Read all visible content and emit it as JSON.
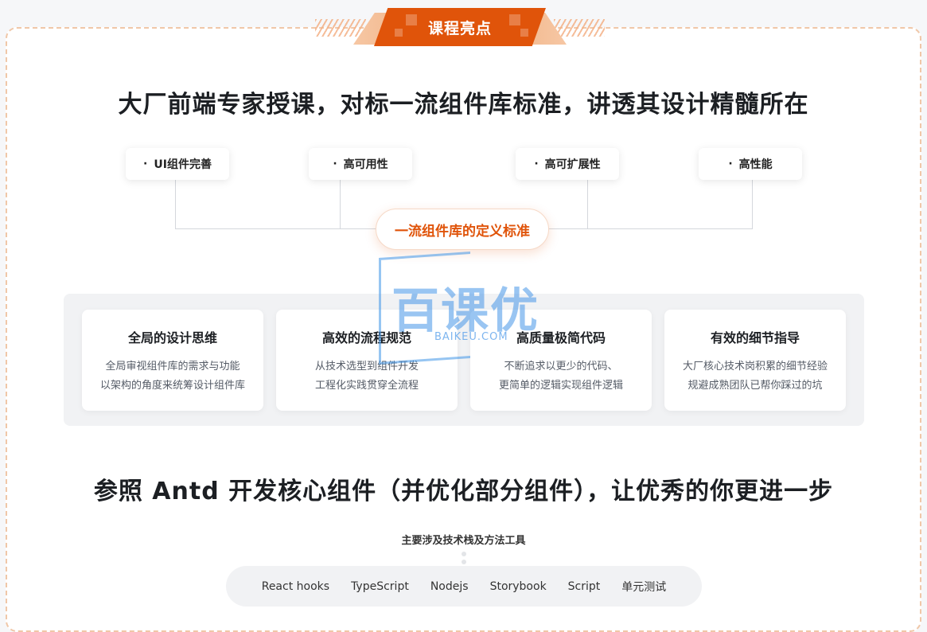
{
  "header": {
    "badge": "课程亮点"
  },
  "headline_1": "大厂前端专家授课，对标一流组件库标准，讲透其设计精髓所在",
  "chips": [
    {
      "bullet": "·",
      "label": "UI组件完善"
    },
    {
      "bullet": "·",
      "label": "高可用性"
    },
    {
      "bullet": "·",
      "label": "高可扩展性"
    },
    {
      "bullet": "·",
      "label": "高性能"
    }
  ],
  "center_label": "一流组件库的定义标准",
  "watermark": {
    "text": "百课优",
    "sub": "BAIKEU.COM"
  },
  "features": [
    {
      "title": "全局的设计思维",
      "lines": [
        "全局审视组件库的需求与功能",
        "以架构的角度来统筹设计组件库"
      ]
    },
    {
      "title": "高效的流程规范",
      "lines": [
        "从技术选型到组件开发",
        "工程化实践贯穿全流程"
      ]
    },
    {
      "title": "高质量极简代码",
      "lines": [
        "不断追求以更少的代码、",
        "更简单的逻辑实现组件逻辑"
      ]
    },
    {
      "title": "有效的细节指导",
      "lines": [
        "大厂核心技术岗积累的细节经验",
        "规避成熟团队已帮你踩过的坑"
      ]
    }
  ],
  "headline_2": "参照 Antd 开发核心组件（并优化部分组件），让优秀的你更进一步",
  "tech_section": {
    "title": "主要涉及技术栈及方法工具",
    "items": [
      "React hooks",
      "TypeScript",
      "Nodejs",
      "Storybook",
      "Script",
      "单元测试"
    ]
  },
  "colors": {
    "accent": "#e0540a",
    "dashed_border": "#f0c7a8",
    "panel": "#f1f2f4"
  }
}
